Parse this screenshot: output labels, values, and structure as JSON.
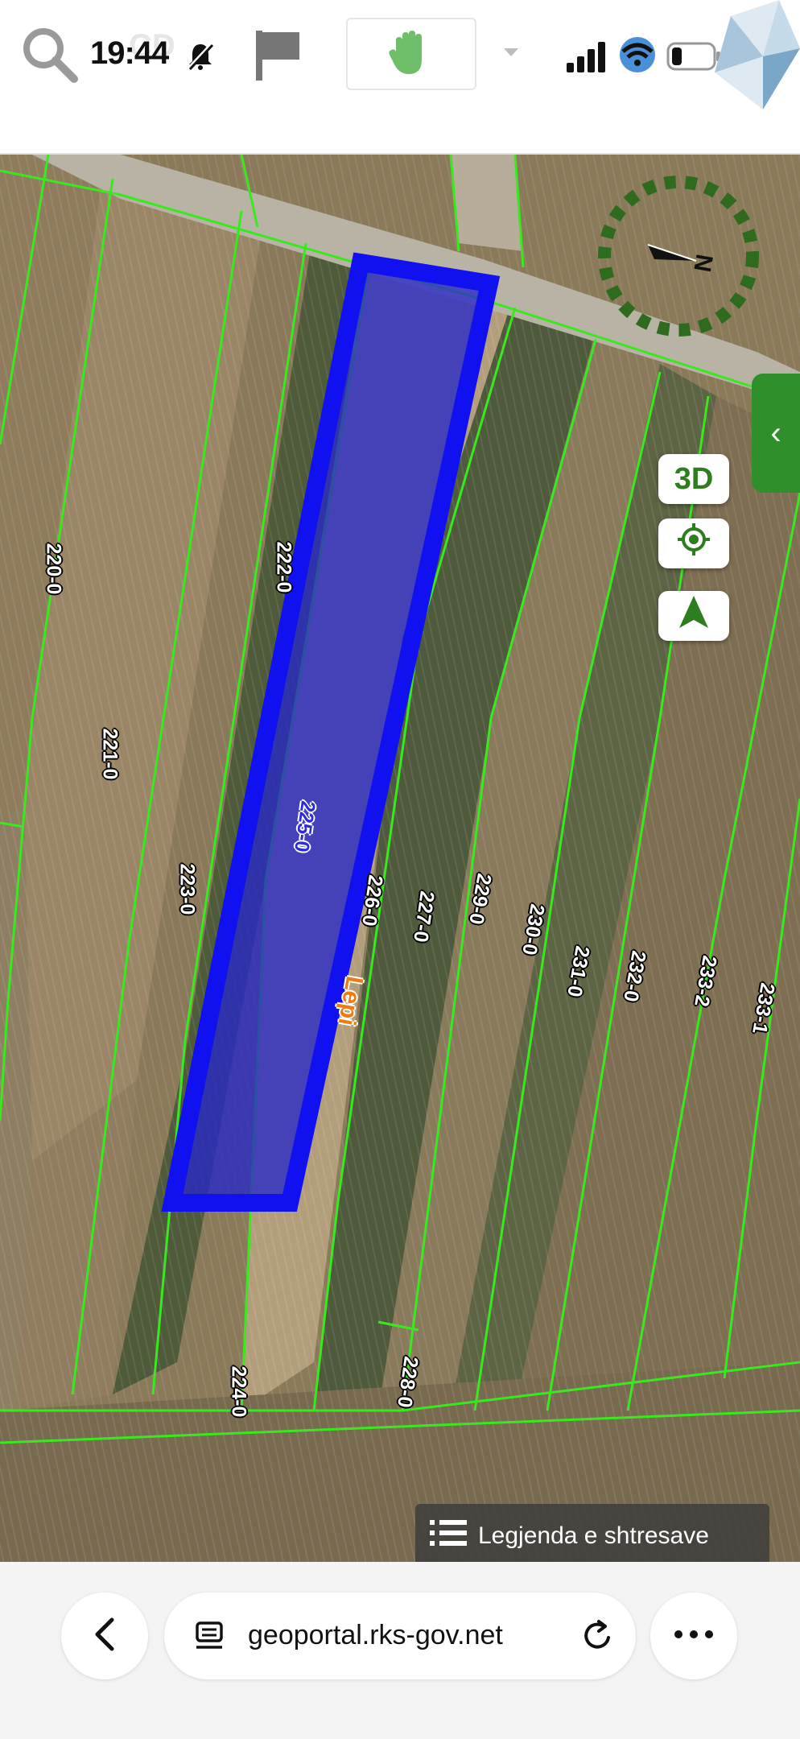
{
  "status": {
    "time": "19:44"
  },
  "toolbar": {
    "search_icon": "search-icon",
    "flag_icon": "flag-icon",
    "hand_icon": "hand-icon"
  },
  "map": {
    "parcels": [
      "220-0",
      "221-0",
      "222-0",
      "223-0",
      "224-0",
      "225-0",
      "226-0",
      "227-0",
      "228-0",
      "229-0",
      "230-0",
      "231-0",
      "232-0",
      "233-2",
      "233-1"
    ],
    "selected_parcel": "225-0",
    "place_name": "Lepi",
    "compass_label": "N",
    "buttons": {
      "view_3d": "3D"
    },
    "legend_label": "Legjenda e shtresave",
    "colors": {
      "parcel_line": "#39e81f",
      "selected_fill": "#2626c8",
      "selected_stroke": "#1010f0",
      "accent": "#2e7d1e",
      "place_label": "#f07a10"
    }
  },
  "browser": {
    "url": "geoportal.rks-gov.net"
  }
}
